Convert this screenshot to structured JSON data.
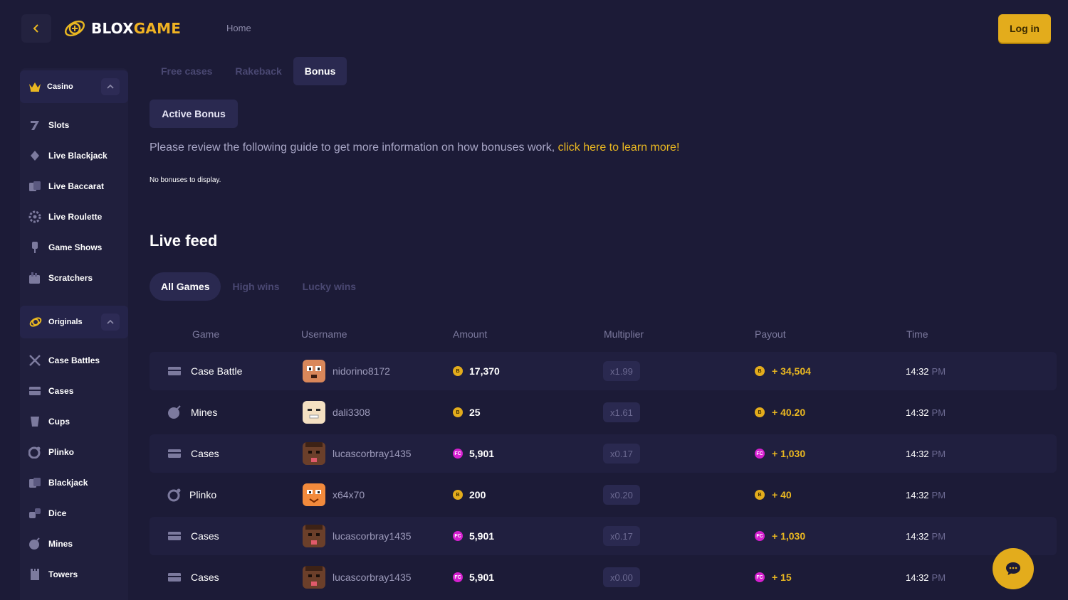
{
  "header": {
    "logo_part1": "BLOX",
    "logo_part2": "GAME",
    "nav_home": "Home",
    "login_label": "Log in"
  },
  "sidebar": {
    "casino": {
      "label": "Casino",
      "items": [
        "Slots",
        "Live Blackjack",
        "Live Baccarat",
        "Live Roulette",
        "Game Shows",
        "Scratchers"
      ]
    },
    "originals": {
      "label": "Originals",
      "items": [
        "Case Battles",
        "Cases",
        "Cups",
        "Plinko",
        "Blackjack",
        "Dice",
        "Mines",
        "Towers"
      ]
    }
  },
  "tabs": [
    "Free cases",
    "Rakeback",
    "Bonus"
  ],
  "active_tab": "Bonus",
  "active_bonus_label": "Active Bonus",
  "guide": {
    "text": "Please review the following guide to get more information on how bonuses work, ",
    "link": "click here to learn more",
    "suffix": "!"
  },
  "no_bonus": "No bonuses to display.",
  "live_feed": {
    "title": "Live feed",
    "tabs": [
      "All Games",
      "High wins",
      "Lucky wins"
    ],
    "columns": [
      "Game",
      "Username",
      "Amount",
      "Multiplier",
      "Payout",
      "Time"
    ],
    "rows": [
      {
        "game": "Case Battle",
        "username": "nidorino8172",
        "coin": "B",
        "amount": "17,370",
        "multiplier": "x1.99",
        "payout": "+ 34,504",
        "time": "14:32",
        "ampm": "PM"
      },
      {
        "game": "Mines",
        "username": "dali3308",
        "coin": "B",
        "amount": "25",
        "multiplier": "x1.61",
        "payout": "+ 40.20",
        "time": "14:32",
        "ampm": "PM"
      },
      {
        "game": "Cases",
        "username": "lucascorbray1435",
        "coin": "FC",
        "amount": "5,901",
        "multiplier": "x0.17",
        "payout": "+ 1,030",
        "time": "14:32",
        "ampm": "PM"
      },
      {
        "game": "Plinko",
        "username": "x64x70",
        "coin": "B",
        "amount": "200",
        "multiplier": "x0.20",
        "payout": "+ 40",
        "time": "14:32",
        "ampm": "PM"
      },
      {
        "game": "Cases",
        "username": "lucascorbray1435",
        "coin": "FC",
        "amount": "5,901",
        "multiplier": "x0.17",
        "payout": "+ 1,030",
        "time": "14:32",
        "ampm": "PM"
      },
      {
        "game": "Cases",
        "username": "lucascorbray1435",
        "coin": "FC",
        "amount": "5,901",
        "multiplier": "x0.00",
        "payout": "+ 15",
        "time": "14:32",
        "ampm": "PM"
      }
    ]
  },
  "colors": {
    "background": "#1c1b37",
    "accent_gold": "#e3ac1c",
    "fc_coin": "#d61fd0",
    "muted_text": "#7c7a9e"
  }
}
